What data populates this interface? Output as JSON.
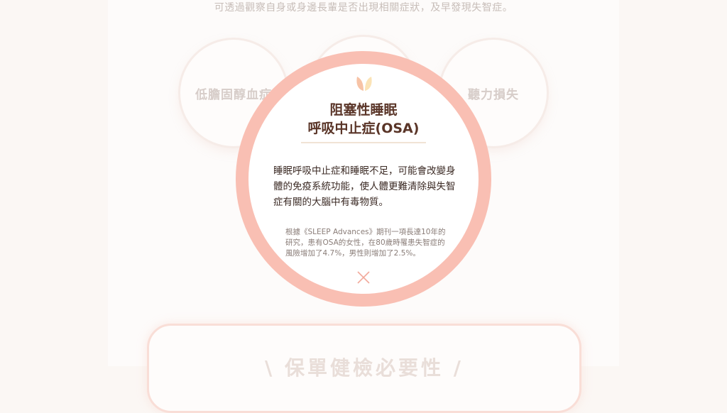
{
  "background": {
    "subtitle": "可透過觀察自身或身邊長輩是否出現相關症狀，及早發現失智症。",
    "circles": [
      "低膽固醇血症",
      "",
      "聽力損失"
    ],
    "card_title": "\\ 保單健檢必要性 /"
  },
  "modal": {
    "icon": "leaf-icon",
    "title_line1": "阻塞性睡眠",
    "title_line2": "呼吸中止症(OSA)",
    "body": "睡眠呼吸中止症和睡眠不足，可能會改變身體的免疫系統功能，使人體更難清除與失智症有關的大腦中有毒物質。",
    "note": "根據《SLEEP Advances》期刊一項長達10年的研究，患有OSA的女性，在80歲時罹患失智症的風險增加了4.7%，男性則增加了2.5%。",
    "close_icon": "close-icon"
  },
  "colors": {
    "ring": "#f9bfb3",
    "title": "#5a3528",
    "leaf_left": "#f7c3a6",
    "leaf_right": "#fbe3b6"
  }
}
